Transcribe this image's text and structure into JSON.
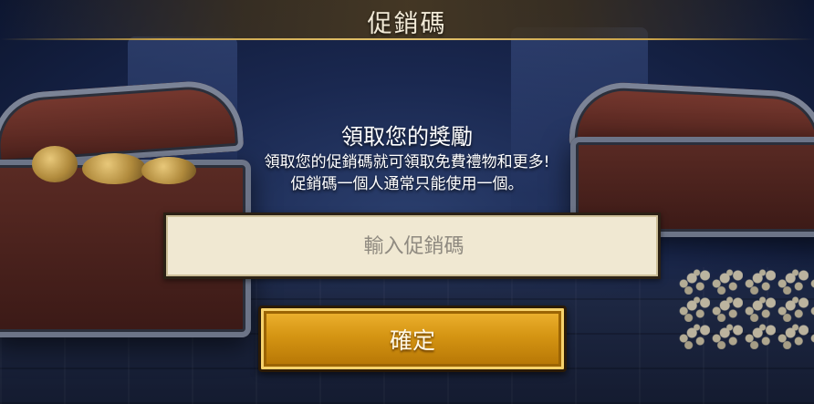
{
  "header": {
    "title": "促銷碼"
  },
  "content": {
    "heading": "領取您的獎勵",
    "description_line1": "領取您的促銷碼就可領取免費禮物和更多!",
    "description_line2": "促銷碼一個人通常只能使用一個。"
  },
  "form": {
    "code_placeholder": "輸入促銷碼",
    "code_value": "",
    "confirm_label": "確定"
  },
  "colors": {
    "title_gold": "#c9a34a",
    "button_gold": "#d59513",
    "input_bg": "#f0e8d2",
    "background_blue": "#1a2850"
  },
  "icons": {
    "background": "treasure-chests-scene"
  }
}
